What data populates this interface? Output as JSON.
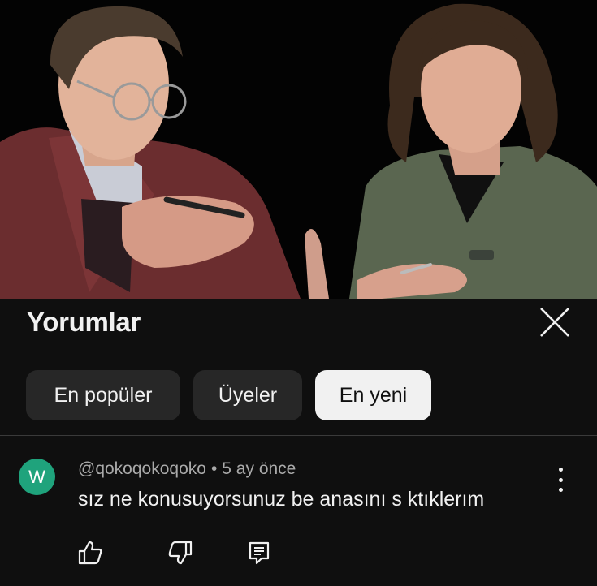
{
  "video": {
    "description_icon": "video-frame"
  },
  "sheet": {
    "title": "Yorumlar",
    "close_icon": "close-icon"
  },
  "chips": [
    {
      "label": "En popüler",
      "selected": false
    },
    {
      "label": "Üyeler",
      "selected": false
    },
    {
      "label": "En yeni",
      "selected": true
    }
  ],
  "comment": {
    "avatar_letter": "W",
    "avatar_color": "#1fa37c",
    "author": "@qokoqokoqoko",
    "separator": "•",
    "time": "5 ay önce",
    "text": "sız ne konusuyorsunuz be anasını s ktıklerım",
    "actions": [
      "like-icon",
      "dislike-icon",
      "reply-icon"
    ]
  },
  "colors": {
    "background": "#0f0f0f",
    "chip": "#272727",
    "chip_selected": "#f1f1f1",
    "secondary_text": "#aaaaaa"
  }
}
